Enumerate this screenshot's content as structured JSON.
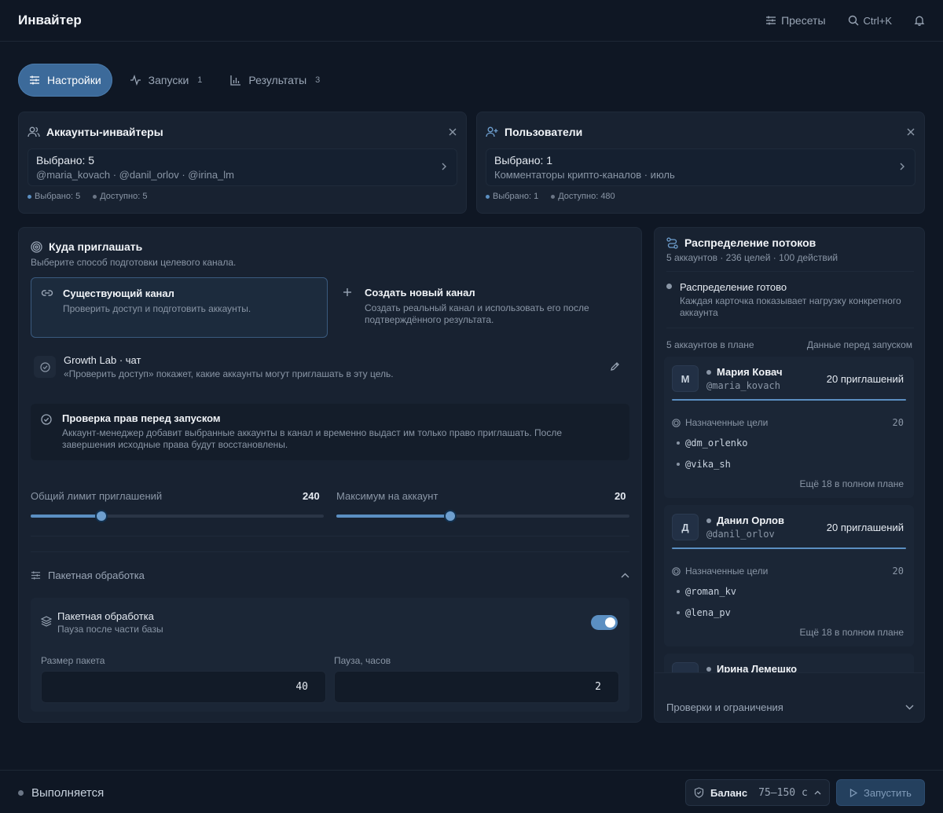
{
  "app": {
    "title": "Инвайтер"
  },
  "header": {
    "presets": "Пресеты",
    "search_shortcut": "Ctrl+K"
  },
  "tabs": [
    {
      "label": "Настройки",
      "count": ""
    },
    {
      "label": "Запуски",
      "count": "1"
    },
    {
      "label": "Результаты",
      "count": "3"
    }
  ],
  "inviters": {
    "title": "Аккаунты-инвайтеры",
    "selected": "Выбрано: 5",
    "summary": "@maria_kovach · @danil_orlov · @irina_lm",
    "stat_selected": "Выбрано: 5",
    "stat_available": "Доступно: 5"
  },
  "users": {
    "title": "Пользователи",
    "selected": "Выбрано: 1",
    "summary": "Комментаторы крипто-каналов · июль",
    "stat_selected": "Выбрано: 1",
    "stat_available": "Доступно: 480"
  },
  "target": {
    "title": "Куда приглашать",
    "subtitle": "Выберите способ подготовки целевого канала.",
    "existing_title": "Существующий канал",
    "existing_desc": "Проверить доступ и подготовить аккаунты.",
    "new_title": "Создать новый канал",
    "new_desc": "Создать реальный канал и использовать его после подтверждённого результата.",
    "channel_name": "Growth Lab · чат",
    "channel_hint": "«Проверить доступ» покажет, какие аккаунты могут приглашать в эту цель.",
    "rights_title": "Проверка прав перед запуском",
    "rights_desc": "Аккаунт-менеджер добавит выбранные аккаунты в канал и временно выдаст им только право приглашать. После завершения исходные права будут восстановлены."
  },
  "limits": {
    "total_label": "Общий лимит приглашений",
    "total_value": "240",
    "total_fraction": 0.24,
    "per_account_label": "Максимум на аккаунт",
    "per_account_value": "20",
    "per_account_fraction": 0.39
  },
  "batch": {
    "section_title": "Пакетная обработка",
    "toggle_title": "Пакетная обработка",
    "toggle_desc": "Пауза после части базы",
    "enabled": true,
    "size_label": "Размер пакета",
    "size_value": "40",
    "pause_label": "Пауза, часов",
    "pause_value": "2"
  },
  "distribution": {
    "title": "Распределение потоков",
    "subtitle": "5 аккаунтов · 236 целей · 100 действий",
    "ready_title": "Распределение готово",
    "ready_desc": "Каждая карточка показывает нагрузку конкретного аккаунта",
    "plan_count": "5 аккаунтов в плане",
    "plan_note": "Данные перед запуском",
    "targets_label": "Назначенные цели",
    "accounts": [
      {
        "initial": "М",
        "name": "Мария Ковач",
        "handle": "@maria_kovach",
        "invites": "20 приглашений",
        "targets_count": "20",
        "targets": [
          "@dm_orlenko",
          "@vika_sh"
        ],
        "more": "Ещё 18 в полном плане"
      },
      {
        "initial": "Д",
        "name": "Данил Орлов",
        "handle": "@danil_orlov",
        "invites": "20 приглашений",
        "targets_count": "20",
        "targets": [
          "@roman_kv",
          "@lena_pv"
        ],
        "more": "Ещё 18 в полном плане"
      },
      {
        "initial": "И",
        "name": "Ирина Лемешко",
        "handle": "",
        "invites": "",
        "targets_count": "",
        "targets": [],
        "more": ""
      }
    ],
    "checks_label": "Проверки и ограничения"
  },
  "footer": {
    "status": "Выполняется",
    "balance_label": "Баланс",
    "balance_value": "75–150 с",
    "run_label": "Запустить"
  },
  "colors": {
    "accent": "#3c6a9a",
    "background": "#0f1724",
    "panel": "#182231"
  }
}
